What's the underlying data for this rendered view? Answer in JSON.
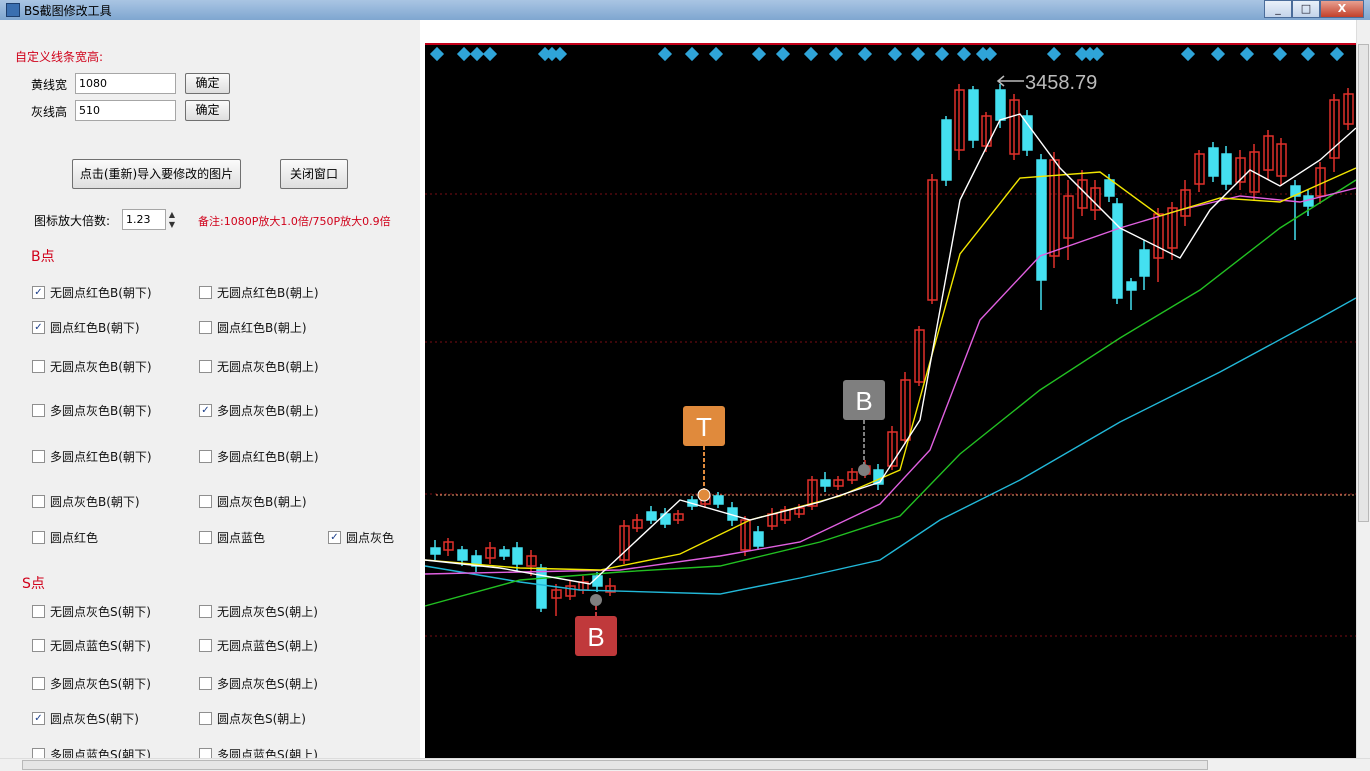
{
  "window": {
    "title": "BS截图修改工具",
    "min": "_",
    "max": "□",
    "close": "X"
  },
  "size_section": {
    "title": "自定义线条宽高:",
    "yellow_label": "黄线宽",
    "yellow_value": "1080",
    "gray_label": "灰线高",
    "gray_value": "510",
    "confirm": "确定"
  },
  "actions": {
    "import": "点击(重新)导入要修改的图片",
    "close_window": "关闭窗口"
  },
  "zoom": {
    "label": "图标放大倍数:",
    "value": "1.23",
    "note": "备注:1080P放大1.0倍/750P放大0.9倍"
  },
  "b_section": {
    "title": "B点",
    "items": [
      {
        "label": "无圆点红色B(朝下)",
        "checked": true
      },
      {
        "label": "无圆点红色B(朝上)",
        "checked": false
      },
      {
        "label": "圆点红色B(朝下)",
        "checked": true
      },
      {
        "label": "圆点红色B(朝上)",
        "checked": false
      },
      {
        "label": "无圆点灰色B(朝下)",
        "checked": false
      },
      {
        "label": "无圆点灰色B(朝上)",
        "checked": false
      },
      {
        "label": "多圆点灰色B(朝下)",
        "checked": false
      },
      {
        "label": "多圆点灰色B(朝上)",
        "checked": true
      },
      {
        "label": "多圆点红色B(朝下)",
        "checked": false
      },
      {
        "label": "多圆点红色B(朝上)",
        "checked": false
      },
      {
        "label": "圆点灰色B(朝下)",
        "checked": false
      },
      {
        "label": "圆点灰色B(朝上)",
        "checked": false
      }
    ],
    "dots": [
      {
        "label": "圆点红色",
        "checked": false
      },
      {
        "label": "圆点蓝色",
        "checked": false
      },
      {
        "label": "圆点灰色",
        "checked": true
      }
    ]
  },
  "s_section": {
    "title": "S点",
    "items": [
      {
        "label": "无圆点灰色S(朝下)",
        "checked": false
      },
      {
        "label": "无圆点灰色S(朝上)",
        "checked": false
      },
      {
        "label": "无圆点蓝色S(朝下)",
        "checked": false
      },
      {
        "label": "无圆点蓝色S(朝上)",
        "checked": false
      },
      {
        "label": "多圆点灰色S(朝下)",
        "checked": false
      },
      {
        "label": "多圆点灰色S(朝上)",
        "checked": false
      },
      {
        "label": "圆点灰色S(朝下)",
        "checked": true
      },
      {
        "label": "圆点灰色S(朝上)",
        "checked": false
      },
      {
        "label": "多圆点蓝色S(朝下)",
        "checked": false
      },
      {
        "label": "多圆点蓝色S(朝上)",
        "checked": false
      }
    ]
  },
  "chart": {
    "peak_label": "3458.79",
    "markers": [
      {
        "letter": "T",
        "color": "#e08a3c"
      },
      {
        "letter": "B",
        "color": "#7f7f7f"
      },
      {
        "letter": "B",
        "color": "#c0393b"
      }
    ],
    "colors": {
      "up": "#e0302a",
      "down": "#44e0f0",
      "ma1": "#ffffff",
      "ma2": "#f2e600",
      "ma3": "#e060e0",
      "ma4": "#22c022",
      "ma5": "#22b8d8"
    }
  }
}
